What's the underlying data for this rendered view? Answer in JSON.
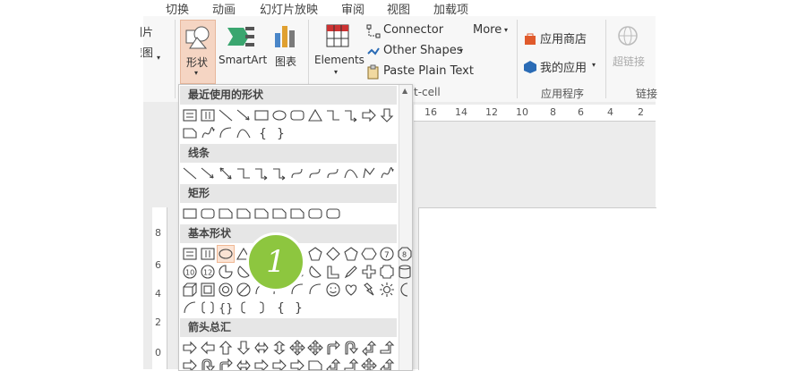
{
  "tabs": [
    "切换",
    "动画",
    "幻灯片放映",
    "审阅",
    "视图",
    "加载项"
  ],
  "ribbon": {
    "left_partial_1": "图片",
    "left_partial_2": "截图",
    "shapes_label": "形状",
    "smartart_label": "SmartArt",
    "chart_label": "图表",
    "elements_label": "Elements",
    "connector_label": "Connector",
    "other_shapes_label": "Other Shapes",
    "paste_plain_text_label": "Paste Plain Text",
    "more_label": "More",
    "group_partial": "t-cell",
    "store_label": "应用商店",
    "my_apps_label": "我的应用",
    "apps_group_label": "应用程序",
    "hyperlink_label": "超链接",
    "links_group_label": "链接"
  },
  "shapes_panel": {
    "categories": [
      "最近使用的形状",
      "线条",
      "矩形",
      "基本形状",
      "箭头总汇"
    ]
  },
  "ruler": {
    "h_ticks": [
      "16",
      "14",
      "12",
      "10",
      "8",
      "6",
      "4",
      "2"
    ],
    "v_ticks": [
      "8",
      "6",
      "4",
      "2",
      "0"
    ]
  },
  "badge": "1",
  "colors": {
    "badge_green": "#8dc63f",
    "ribbon_bg": "#f7f7f7",
    "category_bg": "#e6e6e6",
    "shapes_button_active": "#f5d5c3",
    "accent_orange": "#e05a2b"
  }
}
